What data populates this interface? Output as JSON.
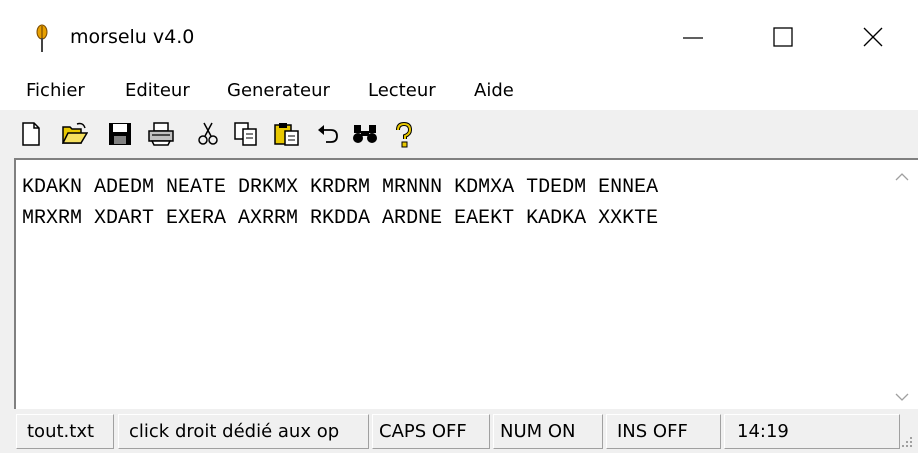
{
  "window": {
    "title": "morselu v4.0",
    "icons": {
      "app": "feather-pen-icon",
      "minimize": "minimize-icon",
      "maximize": "maximize-icon",
      "close": "close-icon"
    }
  },
  "menu": {
    "items": [
      "Fichier",
      "Editeur",
      "Generateur",
      "Lecteur",
      "Aide"
    ]
  },
  "toolbar": {
    "tools": [
      "new-document-icon",
      "open-folder-icon",
      "save-icon",
      "print-icon",
      "cut-icon",
      "copy-icon",
      "paste-icon",
      "undo-icon",
      "find-icon",
      "help-icon"
    ]
  },
  "editor": {
    "lines": [
      "KDAKN ADEDM NEATE DRKMX KRDRM MRNNN KDMXA TDEDM ENNEA",
      "MRXRM XDART EXERA AXRRM RKDDA ARDNE EAEKT KADKA XXKTE"
    ]
  },
  "statusbar": {
    "file": "tout.txt",
    "hint": "click droit dédié aux op",
    "caps": "CAPS OFF",
    "num": "NUM ON",
    "ins": "INS OFF",
    "time": "14:19"
  },
  "colors": {
    "window_bg": "#f0f0f0",
    "titlebar_bg": "#ffffff",
    "text": "#000000",
    "icon_yellow": "#e8c800"
  }
}
